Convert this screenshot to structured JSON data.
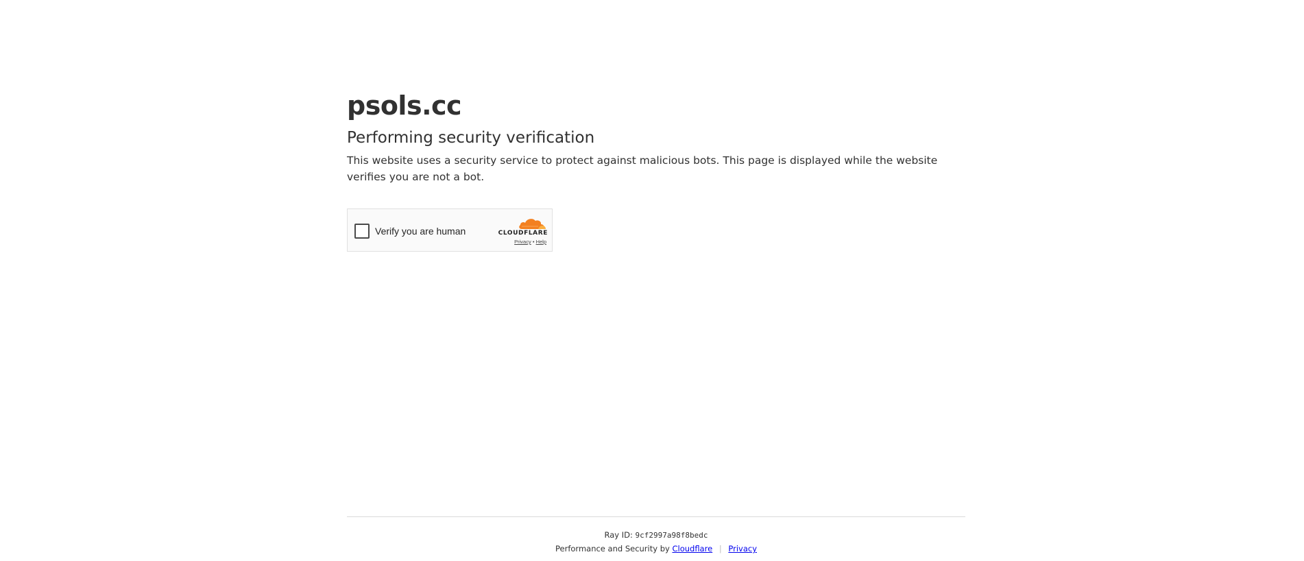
{
  "site": {
    "name": "psols.cc"
  },
  "main": {
    "heading": "Performing security verification",
    "description": "This website uses a security service to protect against malicious bots. This page is displayed while the website verifies you are not a bot."
  },
  "widget": {
    "checkbox_label": "Verify you are human",
    "brand": "CLOUDFLARE",
    "privacy_link": "Privacy",
    "link_separator": "•",
    "help_link": "Help",
    "checked": false
  },
  "footer": {
    "ray_label": "Ray ID:",
    "ray_id": "9cf2997a98f8bedc",
    "perf_text": "Performance and Security by",
    "cloudflare_link": "Cloudflare",
    "separator": "|",
    "privacy_link": "Privacy"
  },
  "colors": {
    "cloudflare_orange": "#f38020",
    "cloudflare_light_orange": "#faae40",
    "link_blue": "#0000ee",
    "text": "#313131"
  }
}
